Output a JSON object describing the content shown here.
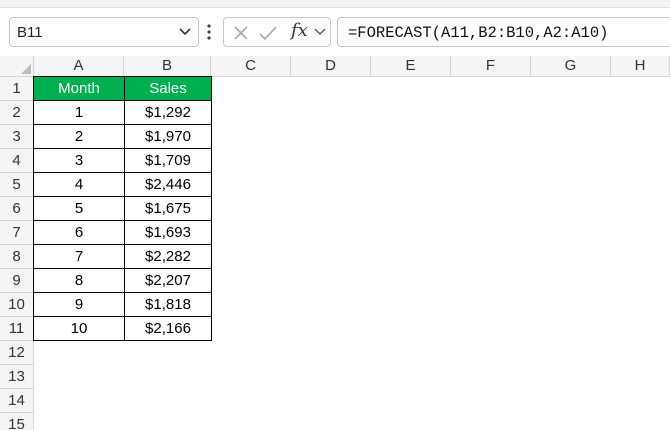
{
  "name_box": {
    "value": "B11"
  },
  "formula_bar": {
    "fx_label": "fx",
    "formula": "=FORECAST(A11,B2:B10,A2:A10)"
  },
  "columns": [
    "A",
    "B",
    "C",
    "D",
    "E",
    "F",
    "G",
    "H"
  ],
  "rows": [
    "1",
    "2",
    "3",
    "4",
    "5",
    "6",
    "7",
    "8",
    "9",
    "10",
    "11",
    "12",
    "13",
    "14",
    "15"
  ],
  "table": {
    "headers": [
      "Month",
      "Sales"
    ],
    "rows": [
      [
        "1",
        "$1,292"
      ],
      [
        "2",
        "$1,970"
      ],
      [
        "3",
        "$1,709"
      ],
      [
        "4",
        "$2,446"
      ],
      [
        "5",
        "$1,675"
      ],
      [
        "6",
        "$1,693"
      ],
      [
        "7",
        "$2,282"
      ],
      [
        "8",
        "$2,207"
      ],
      [
        "9",
        "$1,818"
      ],
      [
        "10",
        "$2,166"
      ]
    ],
    "header_fill": "#00b050",
    "header_text_color": "#ffffff"
  },
  "selected_cell": "B11",
  "accent_color": "#107c41"
}
